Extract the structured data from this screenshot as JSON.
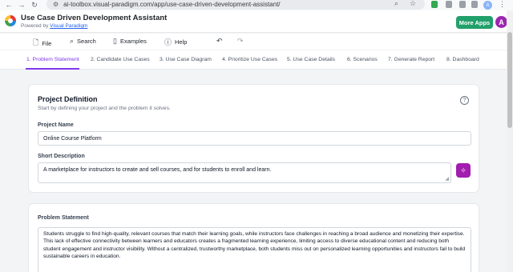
{
  "browser": {
    "url": "ai-toolbox.visual-paradigm.com/app/use-case-driven-development-assistant/",
    "profile_initial": "A"
  },
  "header": {
    "title": "Use Case Driven Development Assistant",
    "powered_prefix": "Powered by ",
    "powered_link": "Visual Paradigm",
    "more_apps": "More Apps",
    "avatar_initial": "A"
  },
  "toolbar": {
    "file": "File",
    "search": "Search",
    "examples": "Examples",
    "help": "Help"
  },
  "steps": [
    "1. Problem Statement",
    "2. Candidate Use Cases",
    "3. Use Case Diagram",
    "4. Prioritize Use Cases",
    "5. Use Case Details",
    "6. Scenarios",
    "7. Generate Report",
    "8. Dashboard"
  ],
  "project": {
    "title": "Project Definition",
    "subtitle": "Start by defining your project and the problem it solves.",
    "name_label": "Project Name",
    "name_value": "Online Course Platform",
    "desc_label": "Short Description",
    "desc_value": "A marketplace for instructors to create and sell courses, and for students to enroll and learn."
  },
  "problem": {
    "label": "Problem Statement",
    "text": "Students struggle to find high-quality, relevant courses that match their learning goals, while instructors face challenges in reaching a broad audience and monetizing their expertise. This lack of effective connectivity between learners and educators creates a fragmented learning experience, limiting access to diverse educational content and reducing both student engagement and instructor visibility. Without a centralized, trustworthy marketplace, both students miss out on personalized learning opportunities and instructors fail to build sustainable careers in education."
  },
  "colors": {
    "accent": "#7c3aed",
    "more_apps": "#22a06b",
    "magic_button": "#a21caf"
  }
}
